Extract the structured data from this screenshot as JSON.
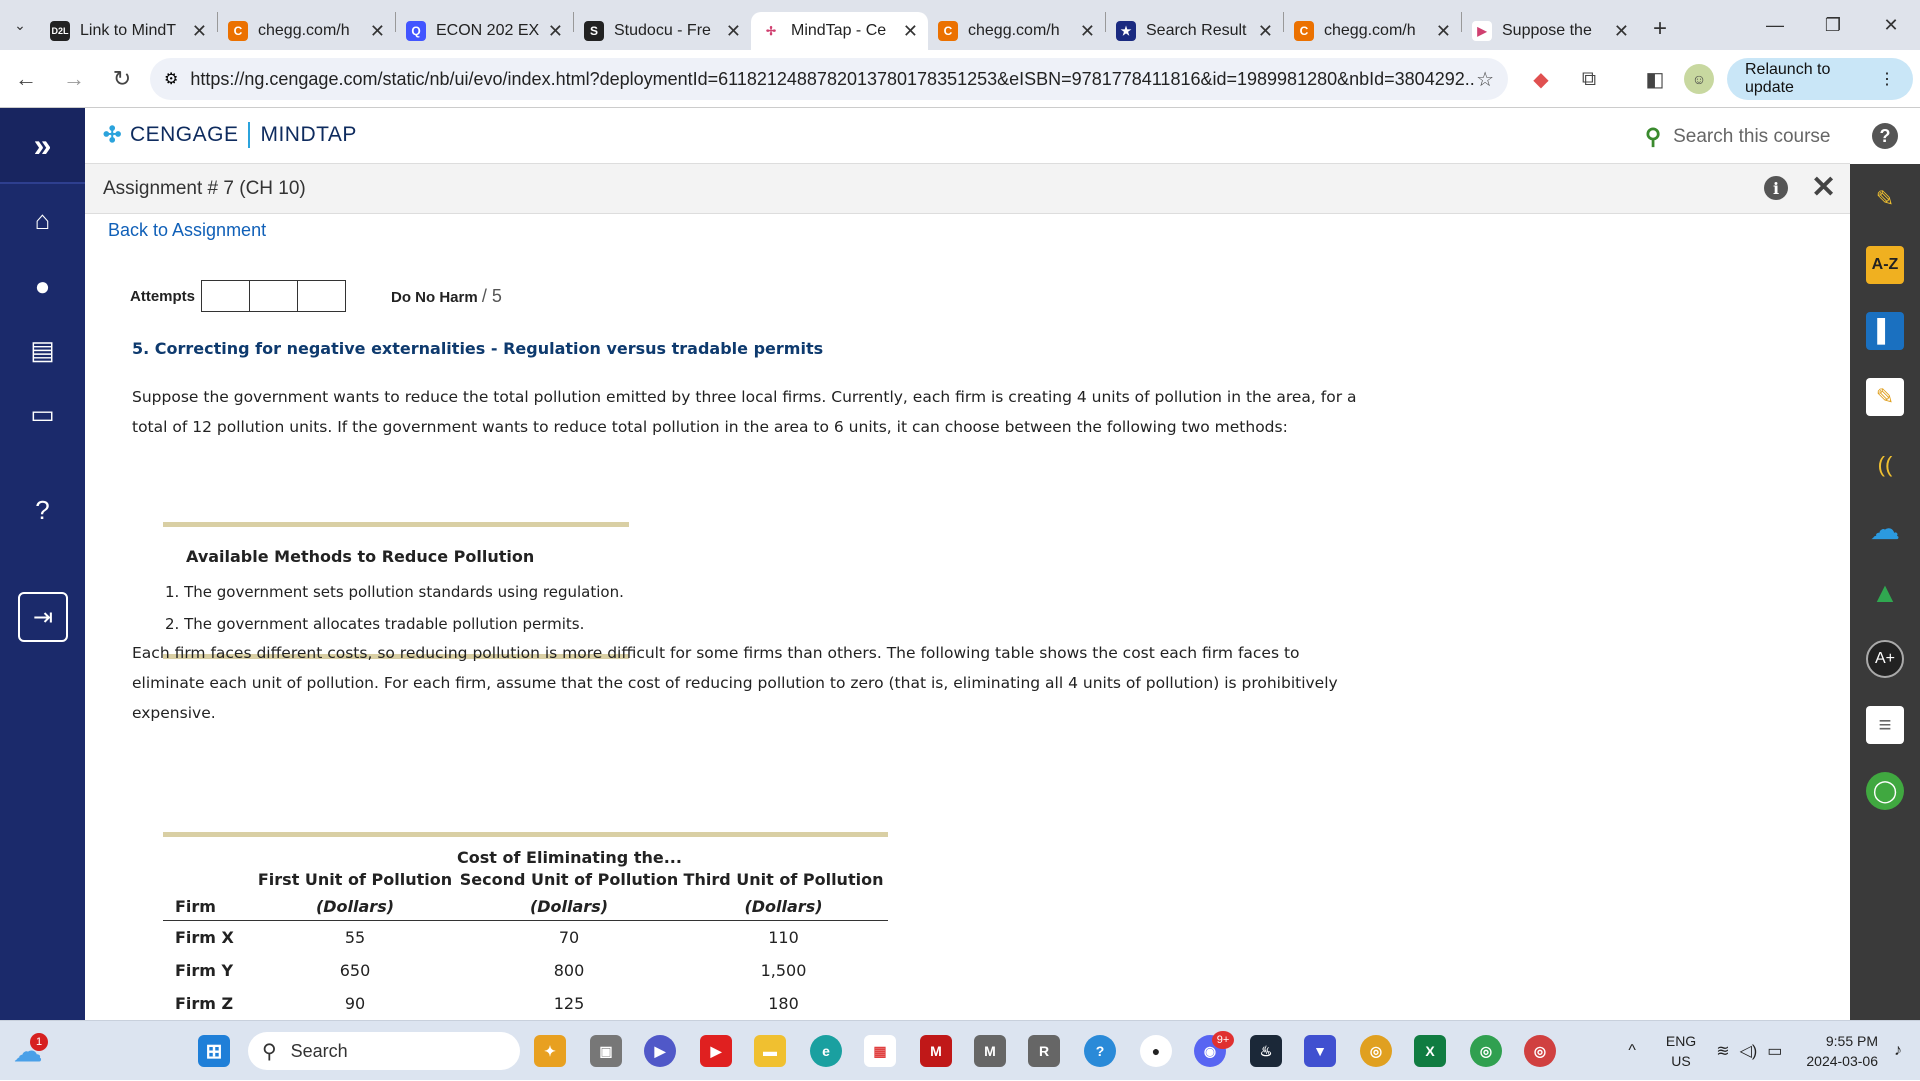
{
  "browser": {
    "tabs": [
      {
        "title": "Link to MindT",
        "icon": "d2l-icon",
        "color": "#222222",
        "glyph": "D2L"
      },
      {
        "title": "chegg.com/h",
        "icon": "chegg-icon",
        "color": "#eb7100",
        "glyph": "C"
      },
      {
        "title": "ECON 202 EX",
        "icon": "quizlet-icon",
        "color": "#4255ff",
        "glyph": "Q"
      },
      {
        "title": "Studocu - Fre",
        "icon": "studocu-icon",
        "color": "#222222",
        "glyph": "S"
      },
      {
        "title": "MindTap - Ce",
        "icon": "mindtap-icon",
        "color": "#ffffff",
        "glyph": "✢",
        "active": true
      },
      {
        "title": "chegg.com/h",
        "icon": "chegg-icon",
        "color": "#eb7100",
        "glyph": "C"
      },
      {
        "title": "Search Result",
        "icon": "star-search-icon",
        "color": "#1a2a80",
        "glyph": "★"
      },
      {
        "title": "chegg.com/h",
        "icon": "chegg-icon",
        "color": "#eb7100",
        "glyph": "C"
      },
      {
        "title": "Suppose the",
        "icon": "play-icon",
        "color": "#ffffff",
        "glyph": "▶"
      }
    ],
    "url": "https://ng.cengage.com/static/nb/ui/evo/index.html?deploymentId=6118212488782013780178351253&eISBN=9781778411816&id=1989981280&nbId=3804292...",
    "relaunch_label": "Relaunch to update"
  },
  "app": {
    "brand_left": "CENGAGE",
    "brand_right": "MINDTAP",
    "search_placeholder": "Search this course",
    "assignment_title": "Assignment # 7 (CH 10)",
    "back_link": "Back to Assignment"
  },
  "question": {
    "attempts_label": "Attempts",
    "dnh_label": "Do No Harm",
    "dnh_points": "/ 5",
    "title": "5. Correcting for negative externalities - Regulation versus tradable permits",
    "intro": "Suppose the government wants to reduce the total pollution emitted by three local firms. Currently, each firm is creating 4 units of pollution in the area, for a total of 12 pollution units. If the government wants to reduce total pollution in the area to 6 units, it can choose between the following two methods:",
    "methods_heading": "Available Methods to Reduce Pollution",
    "methods": [
      "1.  The government sets pollution standards using regulation.",
      "2.  The government allocates tradable pollution permits."
    ],
    "costs_para": "Each firm faces different costs, so reducing pollution is more difficult for some firms than others. The following table shows the cost each firm faces to eliminate each unit of pollution. For each firm, assume that the cost of reducing pollution to zero (that is, eliminating all 4 units of pollution) is prohibitively expensive.",
    "table": {
      "span_header": "Cost of Eliminating the...",
      "firm_header": "Firm",
      "columns": [
        "First Unit of Pollution",
        "Second Unit of Pollution",
        "Third Unit of Pollution"
      ],
      "units": [
        "(Dollars)",
        "(Dollars)",
        "(Dollars)"
      ],
      "rows": [
        {
          "firm": "Firm X",
          "values": [
            "55",
            "70",
            "110"
          ]
        },
        {
          "firm": "Firm Y",
          "values": [
            "650",
            "800",
            "1,500"
          ]
        },
        {
          "firm": "Firm Z",
          "values": [
            "90",
            "125",
            "180"
          ]
        }
      ]
    }
  },
  "taskbar": {
    "search_label": "Search",
    "lang_top": "ENG",
    "lang_bottom": "US",
    "time": "9:55 PM",
    "date": "2024-03-06",
    "weather_badge": "1",
    "discord_badge": "9+"
  }
}
